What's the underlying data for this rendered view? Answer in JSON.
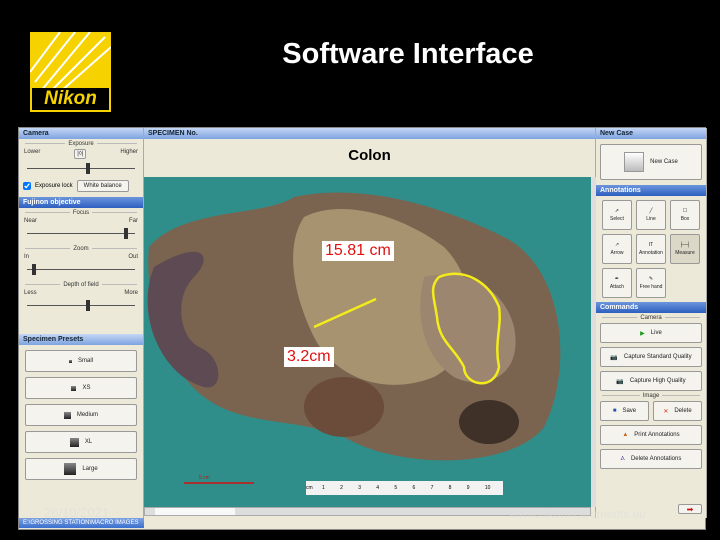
{
  "slide": {
    "title": "Software Interface",
    "logo_text": "Nikon",
    "date": "26/10/2021",
    "website": "www.nikoninstruments.eu"
  },
  "left": {
    "camera": {
      "header": "Camera",
      "group": "Exposure",
      "min_label": "Lower",
      "max_label": "Higher",
      "auto_checkbox": "Exposure lock",
      "balance_button": "White balance",
      "slider_value": 0.55
    },
    "objective": {
      "header": "Fujinon objective",
      "focus": {
        "label": "Focus",
        "min": "Near",
        "max": "Far",
        "value": 0.9
      },
      "zoom": {
        "label": "Zoom",
        "min": "In",
        "max": "Out",
        "value": 0.05
      },
      "dof": {
        "label": "Depth of field",
        "min": "Less",
        "max": "More",
        "value": 0.55
      }
    },
    "presets": {
      "header": "Specimen Presets",
      "items": [
        "Small",
        "XS",
        "Medium",
        "XL",
        "Large"
      ]
    }
  },
  "center": {
    "header": "SPECIMEN No.",
    "specimen_name": "Colon",
    "measurements": [
      "15.81 cm",
      "3.2cm"
    ],
    "scale_bar": "5 cm",
    "ruler_unit": "cm",
    "ruler_ticks": [
      "1",
      "2",
      "3",
      "4",
      "5",
      "6",
      "7",
      "8",
      "9",
      "10"
    ]
  },
  "right": {
    "new_case": {
      "header": "New Case",
      "button": "New Case"
    },
    "annotations": {
      "header": "Annotations",
      "tools": [
        "Select",
        "Line",
        "Box",
        "Arrow",
        "Annotation",
        "Measure",
        "Attach",
        "Free hand"
      ]
    },
    "commands": {
      "header": "Commands",
      "camera_group": "Camera",
      "live": "Live",
      "capture_std": "Capture Standard Quality",
      "capture_high": "Capture High Quality",
      "image_group": "Image",
      "save": "Save",
      "delete": "Delete",
      "print": "Print Annotations",
      "delete_ann": "Delete Annotations"
    }
  },
  "taskbar": {
    "label": "E:\\GROSSING STATION\\MACRO IMAGES"
  }
}
